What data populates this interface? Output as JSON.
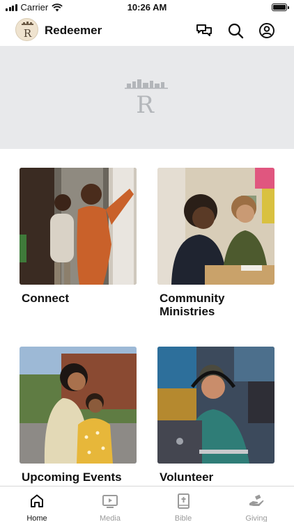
{
  "status_bar": {
    "carrier": "Carrier",
    "time": "10:26 AM"
  },
  "header": {
    "title": "Redeemer",
    "avatar_letter": "R"
  },
  "banner": {
    "logo_letter": "R"
  },
  "cards": [
    {
      "label": "Connect"
    },
    {
      "label": "Community Ministries"
    },
    {
      "label": "Upcoming Events"
    },
    {
      "label": "Volunteer Opportunities"
    }
  ],
  "tabs": [
    {
      "label": "Home",
      "icon": "home-icon",
      "active": true
    },
    {
      "label": "Media",
      "icon": "media-icon",
      "active": false
    },
    {
      "label": "Bible",
      "icon": "bible-icon",
      "active": false
    },
    {
      "label": "Giving",
      "icon": "giving-icon",
      "active": false
    }
  ],
  "colors": {
    "accent": "#111111",
    "inactive_tab": "#9a9a9a",
    "banner_bg": "#e8e9eb"
  }
}
